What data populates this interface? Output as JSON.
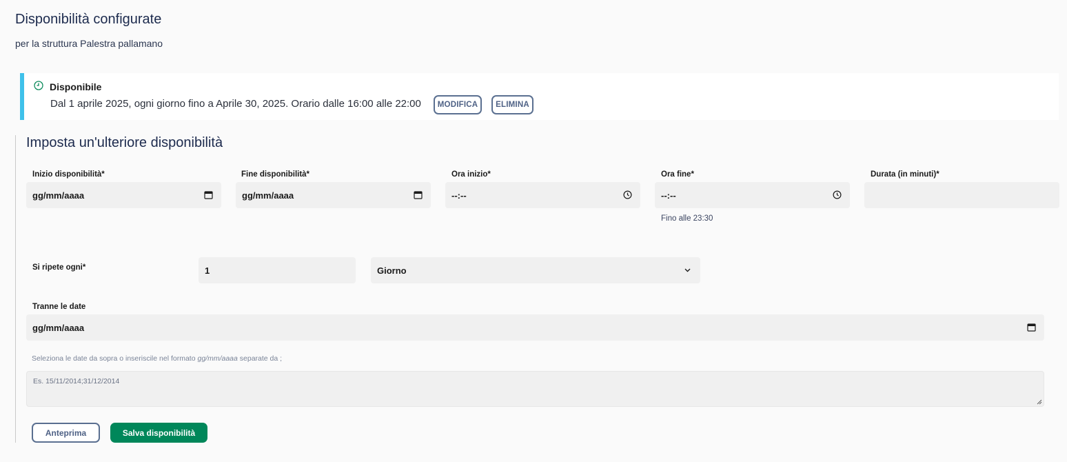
{
  "header": {
    "title": "Disponibilità configurate",
    "subtitle": "per la struttura Palestra pallamano"
  },
  "availability": {
    "status": "Disponibile",
    "description": "Dal 1 aprile 2025, ogni giorno fino a Aprile 30, 2025. Orario dalle 16:00 alle 22:00",
    "edit_label": "MODIFICA",
    "delete_label": "ELIMINA",
    "accent_color": "#3fc1ea",
    "icon": "clock-icon"
  },
  "form": {
    "title": "Imposta un'ulteriore disponibilità",
    "start_date": {
      "label": "Inizio disponibilità*",
      "value": "gg/mm/aaaa"
    },
    "end_date": {
      "label": "Fine disponibilità*",
      "value": "gg/mm/aaaa"
    },
    "start_time": {
      "label": "Ora inizio*",
      "value": "--:--"
    },
    "end_time": {
      "label": "Ora fine*",
      "value": "--:--",
      "hint": "Fino alle 23:30"
    },
    "duration": {
      "label": "Durata (in minuti)*",
      "value": ""
    },
    "repeat": {
      "label": "Si ripete ogni*",
      "count": "1",
      "unit": "Giorno"
    },
    "except_dates": {
      "label": "Tranne le date",
      "value": "gg/mm/aaaa",
      "hint_prefix": "Seleziona le date da sopra o inseriscile nel formato",
      "hint_format": "gg/mm/aaaa",
      "hint_suffix": "separate da ;",
      "placeholder": "Es. 15/11/2014;31/12/2014"
    },
    "preview_label": "Anteprima",
    "save_label": "Salva disponibilità",
    "save_color": "#00875a"
  }
}
